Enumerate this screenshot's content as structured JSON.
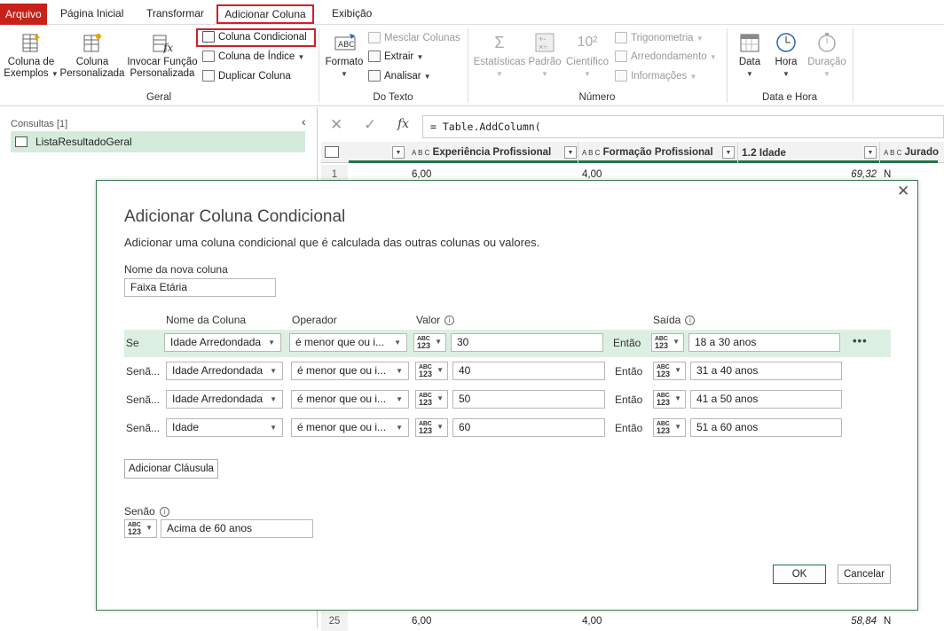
{
  "tabs": {
    "arquivo": "Arquivo",
    "pagina_inicial": "Página Inicial",
    "transformar": "Transformar",
    "adicionar_coluna": "Adicionar Coluna",
    "exibicao": "Exibição"
  },
  "ribbon": {
    "coluna_exemplos_1": "Coluna de",
    "coluna_exemplos_2": "Exemplos",
    "coluna_pers_1": "Coluna",
    "coluna_pers_2": "Personalizada",
    "invocar_1": "Invocar Função",
    "invocar_2": "Personalizada",
    "coluna_condicional": "Coluna Condicional",
    "coluna_indice": "Coluna de Índice",
    "duplicar_coluna": "Duplicar Coluna",
    "group_geral": "Geral",
    "formato": "Formato",
    "mesclar_colunas": "Mesclar Colunas",
    "extrair": "Extrair",
    "analisar": "Analisar",
    "group_texto": "Do Texto",
    "estatisticas": "Estatísticas",
    "padrao": "Padrão",
    "cientifico": "Científico",
    "trigonometria": "Trigonometria",
    "arredondamento": "Arredondamento",
    "informacoes": "Informações",
    "group_numero": "Número",
    "data": "Data",
    "hora": "Hora",
    "duracao": "Duração",
    "group_data_hora": "Data e Hora"
  },
  "queries": {
    "header": "Consultas [1]",
    "item": "ListaResultadoGeral"
  },
  "formula": {
    "text": "= Table.AddColumn("
  },
  "grid": {
    "columns": [
      "Experiência Profissional",
      "Formação Profissional",
      "Idade",
      "Jurado"
    ],
    "type_abc": "A B C",
    "type_num": "1.2",
    "rows": [
      {
        "num": "1",
        "exp": "6,00",
        "form": "4,00",
        "idade": "69,32",
        "jur": "N"
      },
      {
        "num": "25",
        "exp": "6,00",
        "form": "4,00",
        "idade": "58,84",
        "jur": "N"
      }
    ]
  },
  "dialog": {
    "title": "Adicionar Coluna Condicional",
    "subtitle": "Adicionar uma coluna condicional que é calculada das outras colunas ou valores.",
    "new_col_label": "Nome da nova coluna",
    "new_col_value": "Faixa Etária",
    "hdr_coluna": "Nome da Coluna",
    "hdr_operador": "Operador",
    "hdr_valor": "Valor",
    "hdr_saida": "Saída",
    "type_top": "ABC",
    "type_bottom": "123",
    "entao": "Então",
    "rules": [
      {
        "prefix": "Se",
        "column": "Idade Arredondada",
        "operator": "é menor que ou i...",
        "value": "30",
        "output": "18 a 30 anos"
      },
      {
        "prefix": "Senã...",
        "column": "Idade Arredondada",
        "operator": "é menor que ou i...",
        "value": "40",
        "output": "31 a 40 anos"
      },
      {
        "prefix": "Senã...",
        "column": "Idade Arredondada",
        "operator": "é menor que ou i...",
        "value": "50",
        "output": "41 a 50 anos"
      },
      {
        "prefix": "Senã...",
        "column": "Idade",
        "operator": "é menor que ou i...",
        "value": "60",
        "output": "51 a 60 anos"
      }
    ],
    "more": "•••",
    "add_clause": "Adicionar Cláusula",
    "else_label": "Senão",
    "else_value": "Acima de 60 anos",
    "ok": "OK",
    "cancel": "Cancelar"
  },
  "colors": {
    "accent_green": "#217346",
    "highlight_row": "#dcefe3",
    "red_box": "#d0202a",
    "file_tab": "#c8201a"
  }
}
